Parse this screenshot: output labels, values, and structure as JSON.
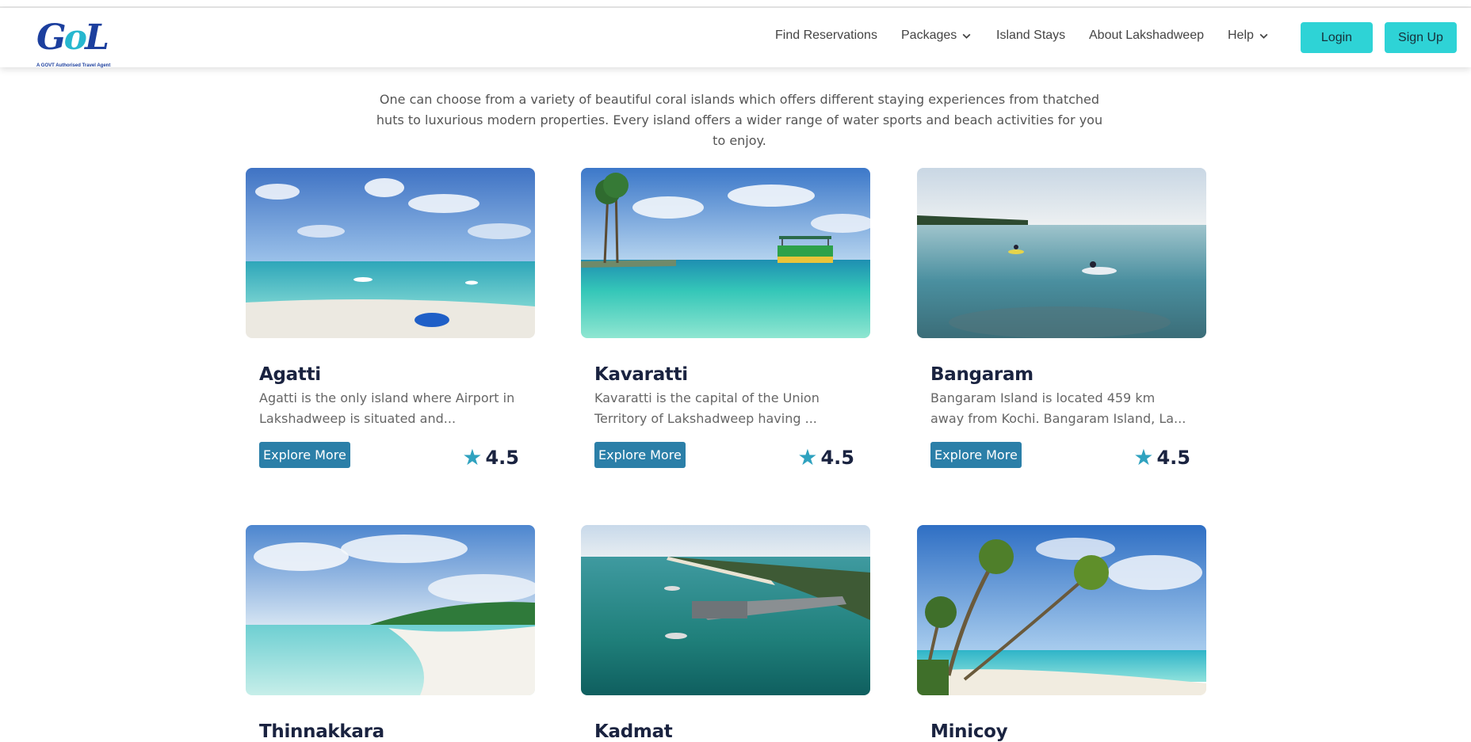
{
  "logo": {
    "text": "GoL",
    "tagline": "A GOVT Authorised Travel Agent"
  },
  "nav": {
    "items": [
      {
        "label": "Find Reservations",
        "has_dropdown": false
      },
      {
        "label": "Packages",
        "has_dropdown": true
      },
      {
        "label": "Island Stays",
        "has_dropdown": false
      },
      {
        "label": "About Lakshadweep",
        "has_dropdown": false
      },
      {
        "label": "Help",
        "has_dropdown": true
      }
    ],
    "login_label": "Login",
    "signup_label": "Sign Up"
  },
  "intro": {
    "text": "One can choose from a variety of beautiful coral islands which offers different staying experiences from thatched huts to luxurious modern properties. Every island offers a wider range of water sports and beach activities for you to enjoy."
  },
  "islands": [
    {
      "name": "Agatti",
      "description": "Agatti is the only island where Airport in Lakshadweep is situated and...",
      "button": "Explore More",
      "rating": "4.5",
      "image": "agatti-beach-photo"
    },
    {
      "name": "Kavaratti",
      "description": "Kavaratti is the capital of the Union Territory of Lakshadweep having ...",
      "button": "Explore More",
      "rating": "4.5",
      "image": "kavaratti-boat-photo"
    },
    {
      "name": "Bangaram",
      "description": "Bangaram Island is located 459 km away from Kochi. Bangaram Island, La...",
      "button": "Explore More",
      "rating": "4.5",
      "image": "bangaram-kayak-photo"
    },
    {
      "name": "Thinnakkara",
      "description": "",
      "button": "",
      "rating": "",
      "image": "thinnakkara-beach-photo"
    },
    {
      "name": "Kadmat",
      "description": "",
      "button": "",
      "rating": "",
      "image": "kadmat-jetty-photo"
    },
    {
      "name": "Minicoy",
      "description": "",
      "button": "",
      "rating": "",
      "image": "minicoy-palms-photo"
    }
  ],
  "colors": {
    "accent": "#2ed3d6",
    "button": "#2b7fa8",
    "star": "#2fa2bf",
    "heading": "#1a2340"
  }
}
